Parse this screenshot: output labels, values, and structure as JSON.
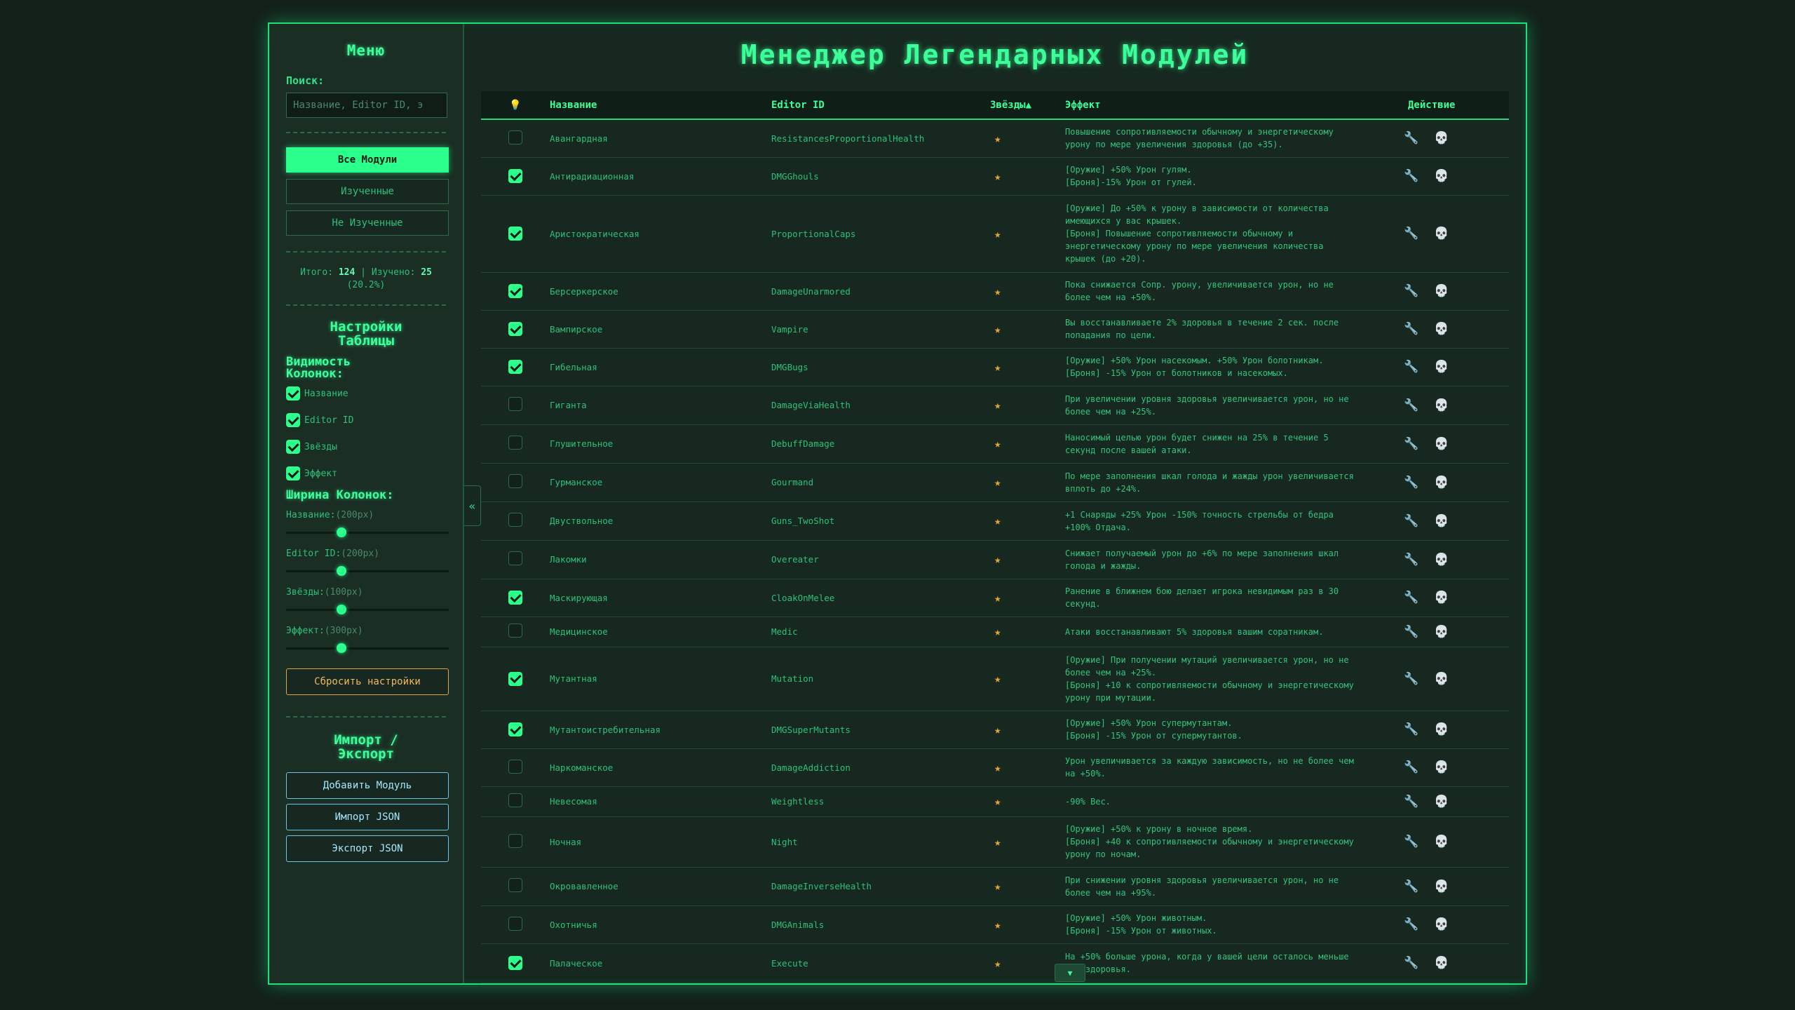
{
  "sidebar": {
    "title": "Меню",
    "search_label": "Поиск:",
    "search_placeholder": "Название, Editor ID, э",
    "filters": [
      "Все Модули",
      "Изученные",
      "Не Изученные"
    ],
    "stats": {
      "total_label": "Итого:",
      "total": "124",
      "sep": "|",
      "learned_label": "Изучено:",
      "learned": "25",
      "percent": "(20.2%)"
    },
    "table_settings_title": "Настройки Таблицы",
    "visibility_title": "Видимость Колонок:",
    "visibility": [
      {
        "label": "Название",
        "checked": true
      },
      {
        "label": "Editor ID",
        "checked": true
      },
      {
        "label": "Звёзды",
        "checked": true
      },
      {
        "label": "Эффект",
        "checked": true
      }
    ],
    "width_title": "Ширина Колонок:",
    "widths": [
      {
        "label": "Название:",
        "value": "(200px)",
        "fraction": 0.34
      },
      {
        "label": "Editor ID:",
        "value": "(200px)",
        "fraction": 0.34
      },
      {
        "label": "Звёзды:",
        "value": "(100px)",
        "fraction": 0.34
      },
      {
        "label": "Эффект:",
        "value": "(300px)",
        "fraction": 0.34
      }
    ],
    "reset_label": "Сбросить настройки",
    "io_title": "Импорт / Экспорт",
    "io_buttons": [
      "Добавить Модуль",
      "Импорт JSON",
      "Экспорт JSON"
    ],
    "collapse_icon": "«"
  },
  "main": {
    "title": "Менеджер Легендарных Модулей",
    "columns": {
      "bulb": "💡",
      "name": "Название",
      "editor_id": "Editor ID",
      "stars": "Звёзды▲",
      "effect": "Эффект",
      "action": "Действие"
    },
    "star_icon": "★",
    "wrench_icon": "🔧",
    "skull_icon": "💀",
    "scroll_icon": "▼",
    "rows": [
      {
        "checked": false,
        "name": "Авангардная",
        "id": "ResistancesProportionalHealth",
        "effect": "Повышение сопротивляемости обычному и энергетическому\nурону по мере увеличения здоровья (до +35).",
        "h": 54
      },
      {
        "checked": true,
        "name": "Антирадиационная",
        "id": "DMGGhouls",
        "effect": "[Оружие] +50% Урон гулям.\n[Броня]-15% Урон от гулей.",
        "h": 54
      },
      {
        "checked": true,
        "name": "Аристократическая",
        "id": "ProportionalCaps",
        "effect": "[Оружие] До +50% к урону в зависимости от количества\nимеющихся у вас крышек.\n[Броня] Повышение сопротивляемости обычному и\nэнергетическому урону по мере увеличения количества\nкрышек (до +20).",
        "h": 110
      },
      {
        "checked": true,
        "name": "Берсеркерское",
        "id": "DamageUnarmored",
        "effect": "Пока снижается Сопр. урону, увеличивается урон, но не\nболее чем на +50%.",
        "h": 54
      },
      {
        "checked": true,
        "name": "Вампирское",
        "id": "Vampire",
        "effect": "Вы восстанавливаете 2% здоровья в течение 2 сек. после\nпопадания по цели.",
        "h": 54
      },
      {
        "checked": true,
        "name": "Гибельная",
        "id": "DMGBugs",
        "effect": "[Оружие] +50% Урон насекомым. +50% Урон болотникам.\n[Броня] -15% Урон от болотников и насекомых.",
        "h": 54
      },
      {
        "checked": false,
        "name": "Гиганта",
        "id": "DamageViaHealth",
        "effect": "При увеличении уровня здоровья увеличивается урон, но не\nболее чем на +25%.",
        "h": 55
      },
      {
        "checked": false,
        "name": "Глушительное",
        "id": "DebuffDamage",
        "effect": "Наносимый целью урон будет снижен на 25% в течение 5\nсекунд после вашей атаки.",
        "h": 55
      },
      {
        "checked": false,
        "name": "Гурманское",
        "id": "Gourmand",
        "effect": "По мере заполнения шкал голода и жажды урон увеличивается\nвплоть до +24%.",
        "h": 55
      },
      {
        "checked": false,
        "name": "Двуствольное",
        "id": "Guns_TwoShot",
        "effect": "+1 Снаряды +25% Урон -150% точность стрельбы от бедра\n+100% Отдача.",
        "h": 55
      },
      {
        "checked": false,
        "name": "Лакомки",
        "id": "Overeater",
        "effect": "Снижает получаемый урон до +6% по мере заполнения шкал\nголода и жажды.",
        "h": 55
      },
      {
        "checked": true,
        "name": "Маскирующая",
        "id": "CloakOnMelee",
        "effect": "Ранение в ближнем бою делает игрока невидимым раз в 30\nсекунд.",
        "h": 54
      },
      {
        "checked": false,
        "name": "Медицинское",
        "id": "Medic",
        "effect": "Атаки восстанавливают 5% здоровья вашим соратникам.",
        "h": 43
      },
      {
        "checked": true,
        "name": "Мутантная",
        "id": "Mutation",
        "effect": "[Оружие] При получении мутаций увеличивается урон, но не\nболее чем на +25%.\n[Броня] +10 к сопротивляемости обычному и энергетическому\nурону при мутации.",
        "h": 91
      },
      {
        "checked": true,
        "name": "Мутантоистребительная",
        "id": "DMGSuperMutants",
        "effect": "[Оружие] +50% Урон супермутантам.\n[Броня] -15% Урон от супермутантов.",
        "h": 54
      },
      {
        "checked": false,
        "name": "Наркоманское",
        "id": "DamageAddiction",
        "effect": "Урон увеличивается за каждую зависимость, но не более чем\nна +50%.",
        "h": 54
      },
      {
        "checked": false,
        "name": "Невесомая",
        "id": "Weightless",
        "effect": "-90% Вес.",
        "h": 43
      },
      {
        "checked": false,
        "name": "Ночная",
        "id": "Night",
        "effect": "[Оружие] +50% к урону в ночное время.\n[Броня] +40 к сопротивляемости обычному и энергетическому\nурону по ночам.",
        "h": 72
      },
      {
        "checked": false,
        "name": "Окровавленное",
        "id": "DamageInverseHealth",
        "effect": "При снижении уровня здоровья увеличивается урон, но не\nболее чем на +95%.",
        "h": 55
      },
      {
        "checked": false,
        "name": "Охотничья",
        "id": "DMGAnimals",
        "effect": "[Оружие] +50% Урон животным.\n[Броня] -15% Урон от животных.",
        "h": 54
      },
      {
        "checked": true,
        "name": "Палаческое",
        "id": "Execute",
        "effect": "На +50% больше урона, когда у вашей цели осталось меньше\n40% здоровья.",
        "h": 56
      }
    ]
  }
}
